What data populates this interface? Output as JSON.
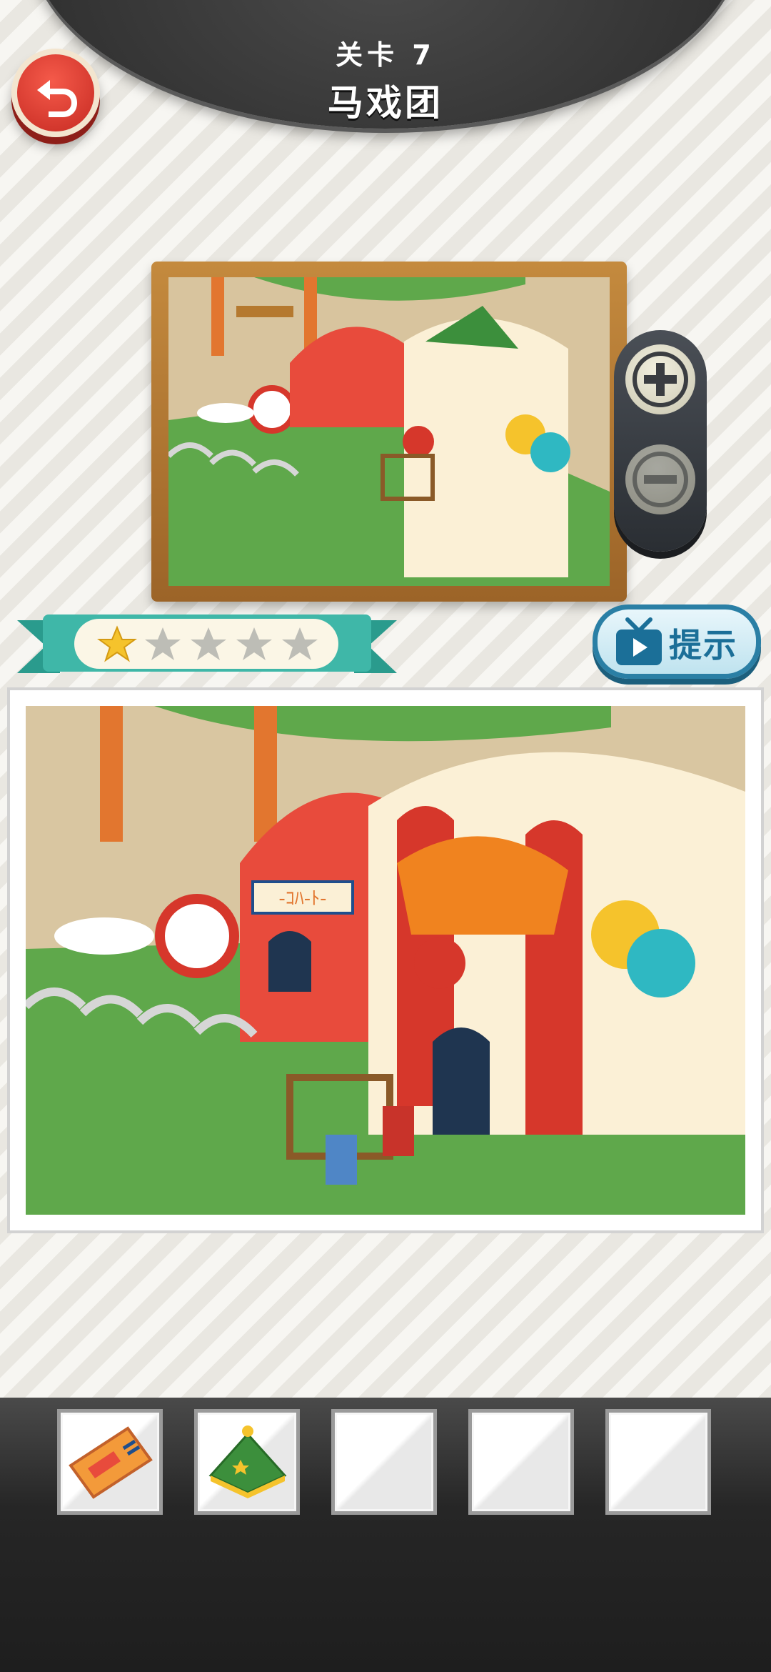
{
  "header": {
    "level_label": "关卡 7",
    "level_name": "马戏团"
  },
  "rating": {
    "stars_total": 5,
    "stars_earned": 1
  },
  "hint": {
    "label": "提示"
  },
  "inventory": {
    "slots": [
      {
        "item": "circus-ticket-icon"
      },
      {
        "item": "clown-hat-icon"
      },
      {
        "item": ""
      },
      {
        "item": ""
      },
      {
        "item": ""
      }
    ]
  },
  "scene": {
    "sign_text": "-ｺﾊ-ﾄ-"
  },
  "colors": {
    "accent_red": "#d6372b",
    "teal": "#3fb7a8",
    "gold": "#f5c32c",
    "hint_blue": "#2a7fa5"
  }
}
